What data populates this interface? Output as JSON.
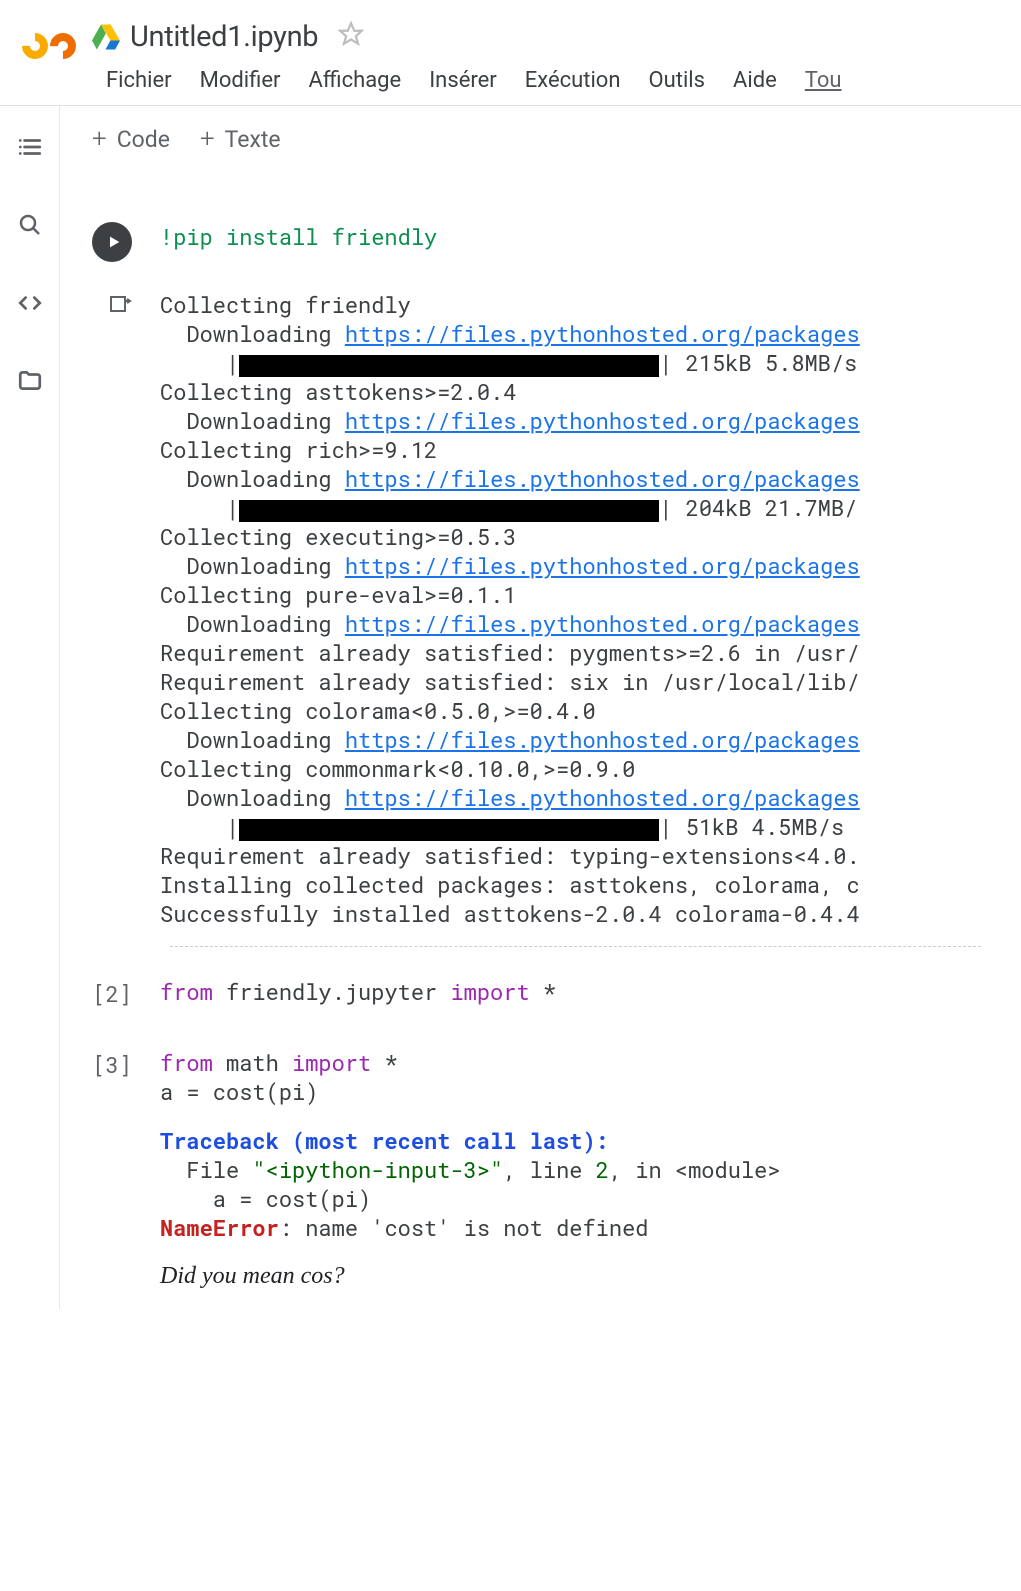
{
  "header": {
    "title": "Untitled1.ipynb",
    "menu": [
      "Fichier",
      "Modifier",
      "Affichage",
      "Insérer",
      "Exécution",
      "Outils",
      "Aide",
      "Tou"
    ]
  },
  "toolbar": {
    "code": "Code",
    "text": "Texte",
    "plus": "+"
  },
  "cells": [
    {
      "type": "code",
      "running": true,
      "source": "!pip install friendly",
      "output": {
        "lines": [
          {
            "t": "Collecting friendly"
          },
          {
            "t": "  Downloading ",
            "link": "https://files.pythonhosted.org/packages"
          },
          {
            "t": "     |",
            "bar": 420,
            "after": "| 215kB 5.8MB/s"
          },
          {
            "t": "Collecting asttokens>=2.0.4"
          },
          {
            "t": "  Downloading ",
            "link": "https://files.pythonhosted.org/packages"
          },
          {
            "t": "Collecting rich>=9.12"
          },
          {
            "t": "  Downloading ",
            "link": "https://files.pythonhosted.org/packages"
          },
          {
            "t": "     |",
            "bar": 420,
            "after": "| 204kB 21.7MB/"
          },
          {
            "t": "Collecting executing>=0.5.3"
          },
          {
            "t": "  Downloading ",
            "link": "https://files.pythonhosted.org/packages"
          },
          {
            "t": "Collecting pure-eval>=0.1.1"
          },
          {
            "t": "  Downloading ",
            "link": "https://files.pythonhosted.org/packages"
          },
          {
            "t": "Requirement already satisfied: pygments>=2.6 in /usr/"
          },
          {
            "t": "Requirement already satisfied: six in /usr/local/lib/"
          },
          {
            "t": "Collecting colorama<0.5.0,>=0.4.0"
          },
          {
            "t": "  Downloading ",
            "link": "https://files.pythonhosted.org/packages"
          },
          {
            "t": "Collecting commonmark<0.10.0,>=0.9.0"
          },
          {
            "t": "  Downloading ",
            "link": "https://files.pythonhosted.org/packages"
          },
          {
            "t": "     |",
            "bar": 420,
            "after": "| 51kB 4.5MB/s"
          },
          {
            "t": "Requirement already satisfied: typing-extensions<4.0."
          },
          {
            "t": "Installing collected packages: asttokens, colorama, c"
          },
          {
            "t": "Successfully installed asttokens-2.0.4 colorama-0.4.4"
          }
        ]
      }
    },
    {
      "type": "code",
      "exec": "[2]",
      "source_tokens": [
        {
          "t": "from",
          "c": "syntax-kw"
        },
        {
          "t": " friendly.jupyter "
        },
        {
          "t": "import",
          "c": "syntax-kw"
        },
        {
          "t": " *"
        }
      ]
    },
    {
      "type": "code",
      "exec": "[3]",
      "source_tokens": [
        {
          "t": "from",
          "c": "syntax-kw"
        },
        {
          "t": " math "
        },
        {
          "t": "import",
          "c": "syntax-kw"
        },
        {
          "t": " *"
        },
        {
          "t": "\n"
        },
        {
          "t": "a = cost(pi)"
        }
      ],
      "traceback": {
        "header": "Traceback (most recent call last):",
        "file_pre": "  File ",
        "file": "\"<ipython-input-3>\"",
        "line_pre": ", line ",
        "line": "2",
        "line_post": ", in <module>",
        "code": "    a = cost(pi)",
        "error": "NameError",
        "msg": ": name 'cost' is not defined"
      },
      "hint": "Did you mean cos?"
    }
  ]
}
